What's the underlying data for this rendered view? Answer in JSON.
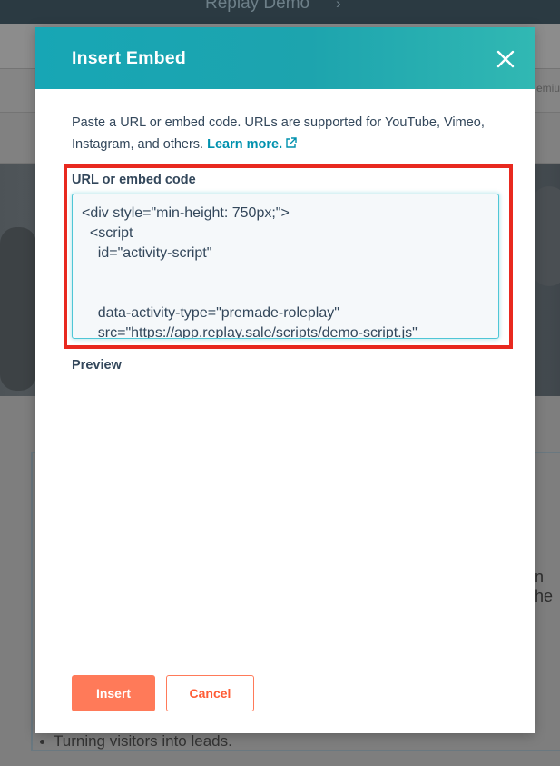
{
  "background": {
    "app_title": "Replay Demo",
    "premium_fragment": "emiu",
    "hint_fragment": "n he",
    "list_item": "Turning visitors into leads."
  },
  "modal": {
    "title": "Insert Embed",
    "description": "Paste a URL or embed code. URLs are supported for YouTube, Vimeo, Instagram, and others.",
    "learn_more": "Learn more.",
    "field_label": "URL or embed code",
    "code_lines": [
      "<div style=\"min-height: 750px;\">",
      "  <script",
      "    id=\"activity-script\"",
      "",
      "",
      "    data-activity-type=\"premade-roleplay\"",
      "    src=\"https://app.replay.sale/scripts/demo-script.js\""
    ],
    "preview_label": "Preview",
    "insert_button": "Insert",
    "cancel_button": "Cancel"
  },
  "colors": {
    "header_start": "#17a6b5",
    "header_end": "#31b8b3",
    "primary_button": "#ff7a59",
    "link": "#0091ae",
    "highlight_border": "#e8291f",
    "text": "#33475b"
  },
  "icons": {
    "close": "close-icon",
    "external_link": "external-link-icon"
  }
}
